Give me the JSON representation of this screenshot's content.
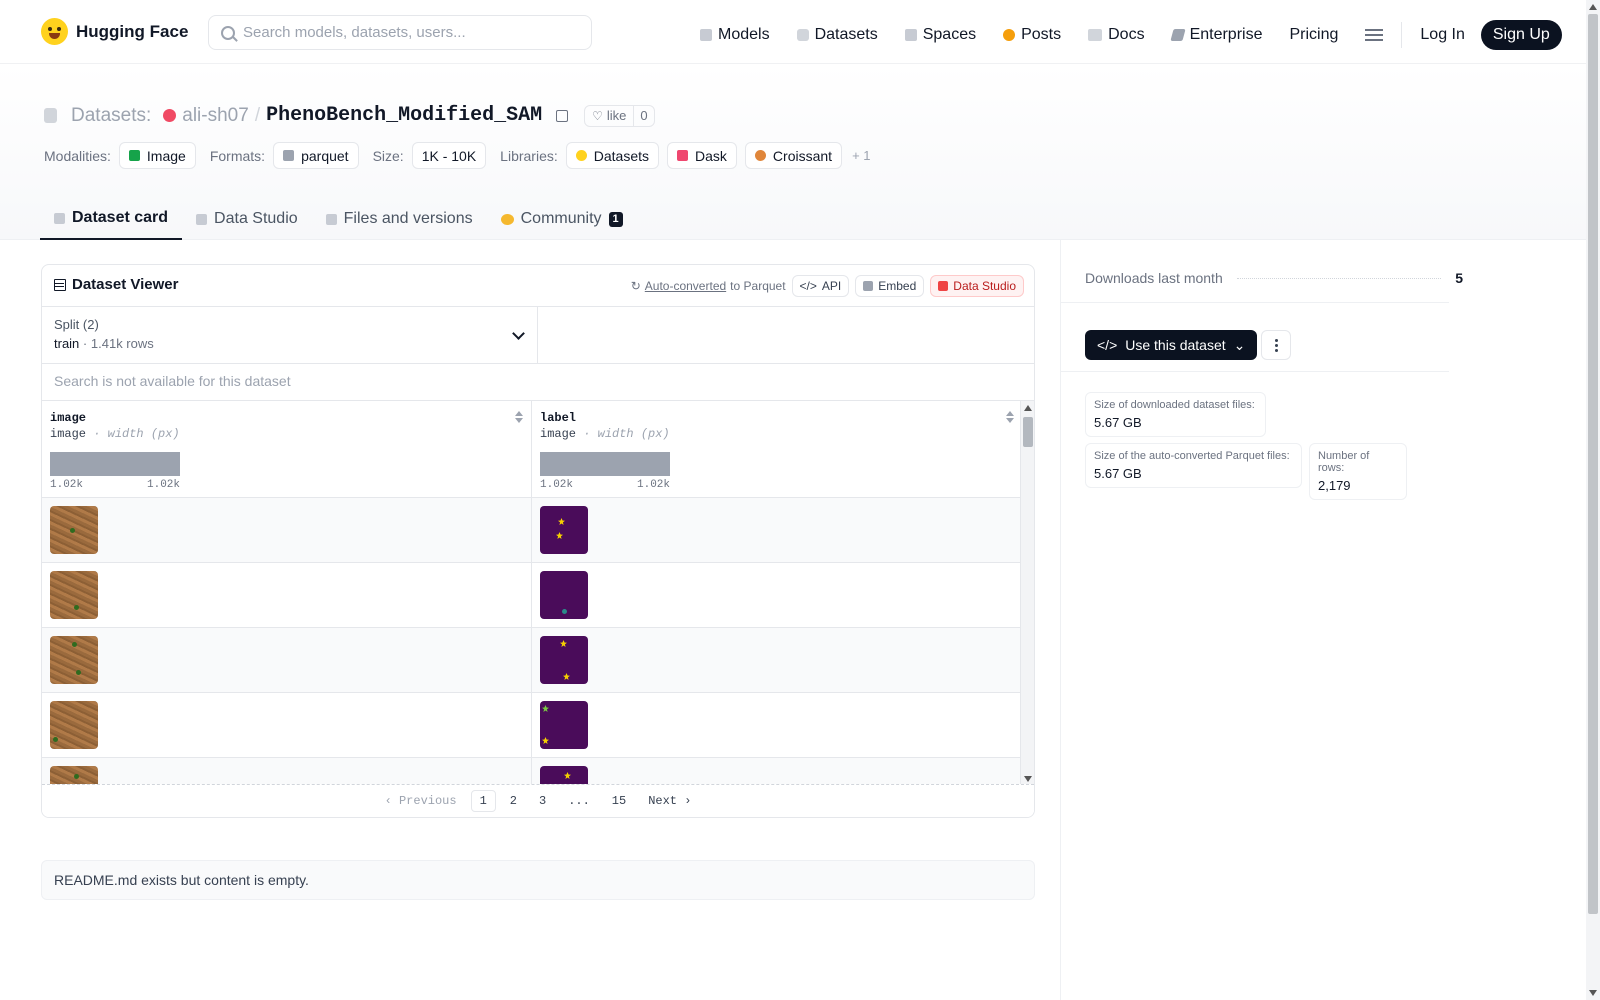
{
  "brand": {
    "name": "Hugging Face"
  },
  "search": {
    "placeholder": "Search models, datasets, users..."
  },
  "nav": {
    "links": [
      {
        "label": "Models",
        "icon": "models-icon"
      },
      {
        "label": "Datasets",
        "icon": "datasets-icon"
      },
      {
        "label": "Spaces",
        "icon": "spaces-icon"
      },
      {
        "label": "Posts",
        "icon": "posts-icon"
      },
      {
        "label": "Docs",
        "icon": "docs-icon"
      },
      {
        "label": "Enterprise",
        "icon": "enterprise-icon"
      },
      {
        "label": "Pricing",
        "icon": ""
      }
    ],
    "login": "Log In",
    "signup": "Sign Up"
  },
  "header": {
    "prefix": "Datasets:",
    "owner": "ali-sh07",
    "slash": "/",
    "name": "PhenoBench_Modified_SAM",
    "like_label": "like",
    "like_count": "0",
    "meta": {
      "modalities_label": "Modalities:",
      "modalities": [
        "Image"
      ],
      "formats_label": "Formats:",
      "formats": [
        "parquet"
      ],
      "size_label": "Size:",
      "size": "1K - 10K",
      "libraries_label": "Libraries:",
      "libraries": [
        "Datasets",
        "Dask",
        "Croissant"
      ],
      "libraries_more": "+ 1"
    },
    "tabs": [
      {
        "label": "Dataset card",
        "active": true
      },
      {
        "label": "Data Studio",
        "active": false
      },
      {
        "label": "Files and versions",
        "active": false
      },
      {
        "label": "Community",
        "active": false,
        "badge": "1"
      }
    ]
  },
  "viewer": {
    "title": "Dataset Viewer",
    "auto_converted": "Auto-converted",
    "to_parquet": "to Parquet",
    "api_label": "API",
    "embed_label": "Embed",
    "studio_label": "Data Studio",
    "split_label": "Split (2)",
    "split_value": "train",
    "split_sep": "·",
    "split_rows": "1.41k rows",
    "search_placeholder": "Search is not available for this dataset",
    "columns": [
      {
        "name": "image",
        "type": "image",
        "sub": "· width (px)",
        "min": "1.02k",
        "max": "1.02k"
      },
      {
        "name": "label",
        "type": "image",
        "sub": "· width (px)",
        "min": "1.02k",
        "max": "1.02k"
      }
    ],
    "pager": {
      "previous": "Previous",
      "pages": [
        "1",
        "2",
        "3",
        "...",
        "15"
      ],
      "current": "1",
      "next": "Next"
    }
  },
  "readme": {
    "text": "README.md exists but content is empty."
  },
  "sidebar": {
    "downloads_label": "Downloads last month",
    "downloads_value": "5",
    "use_button": "Use this dataset",
    "stats": [
      {
        "label": "Size of downloaded dataset files:",
        "value": "5.67 GB"
      },
      {
        "label": "Size of the auto-converted Parquet files:",
        "value": "5.67 GB"
      },
      {
        "label": "Number of rows:",
        "value": "2,179"
      }
    ]
  },
  "colors": {
    "accent": "#0b1220",
    "brand_yellow": "#ffd21e",
    "mask_purple": "#4a0c5a",
    "histogram": "#9ca3af"
  }
}
